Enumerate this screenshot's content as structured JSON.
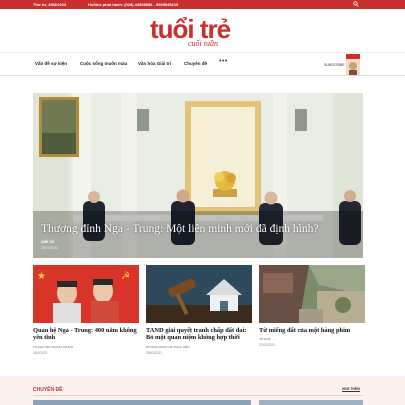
{
  "topbar": {
    "date": "Thứ tư, 29/3/2023",
    "hotline": "Hotline phát hành: (028) 44508686 - 0909545219",
    "color": "#c9302c",
    "icon": "search-icon"
  },
  "logo": {
    "text": "tuổi trẻ",
    "subtext": "cuối tuần",
    "color": "#c9302c"
  },
  "nav": {
    "items": [
      "Vấn đề sự kiện",
      "Cuộc sống muôn màu",
      "Văn hóa Giải trí",
      "Chuyên đề"
    ],
    "more": "•••",
    "subscribe": "SUBSCRIBE"
  },
  "hero": {
    "title": "Thượng đỉnh Nga - Trung: Một liên minh mới đã định hình?",
    "author": "ANH VŨ",
    "date": "28/03/2023"
  },
  "cards": [
    {
      "title": "Quan hệ Nga - Trung: 400 năm không yên tĩnh",
      "author": "TS NGUYỄN THANH TRUNG",
      "date": "28/3/2023"
    },
    {
      "title": "TAND giải quyết tranh chấp đất đai: Bỏ một quan niệm không hợp thời",
      "author": "DƯƠNG NGỌC HẠ THÚC VIỄN",
      "date": "28/03/2023"
    },
    {
      "title": "Từ miếng đất của một hàng phim",
      "author": "VÕ HOÀ",
      "date": "27/03/2023"
    }
  ],
  "section": {
    "heading": "CHUYÊN ĐỀ",
    "see_more": "XEM THÊM"
  }
}
